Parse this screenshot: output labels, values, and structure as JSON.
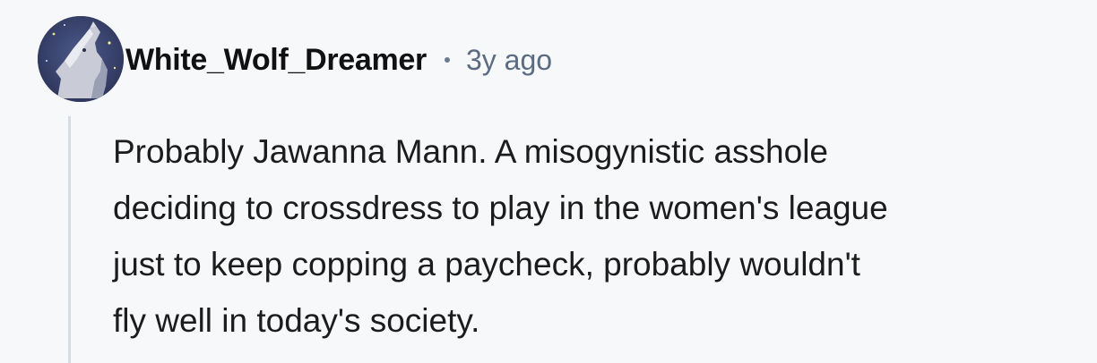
{
  "comment": {
    "author": "White_Wolf_Dreamer",
    "separator": "•",
    "time_ago": "3y ago",
    "body_lines": [
      "Probably Jawanna Mann. A misogynistic asshole",
      "deciding to crossdress to play in the women's league",
      "just to keep copping a paycheck, probably wouldn't",
      "fly well in today's society."
    ]
  },
  "avatar": {
    "icon": "wolf-avatar-icon"
  },
  "colors": {
    "background": "#f7f8fa",
    "username": "#111111",
    "timestamp": "#5b6b82",
    "body_text": "#1c1c1c",
    "thread_line": "#d8dde4",
    "avatar_bg": "#3a4470"
  }
}
